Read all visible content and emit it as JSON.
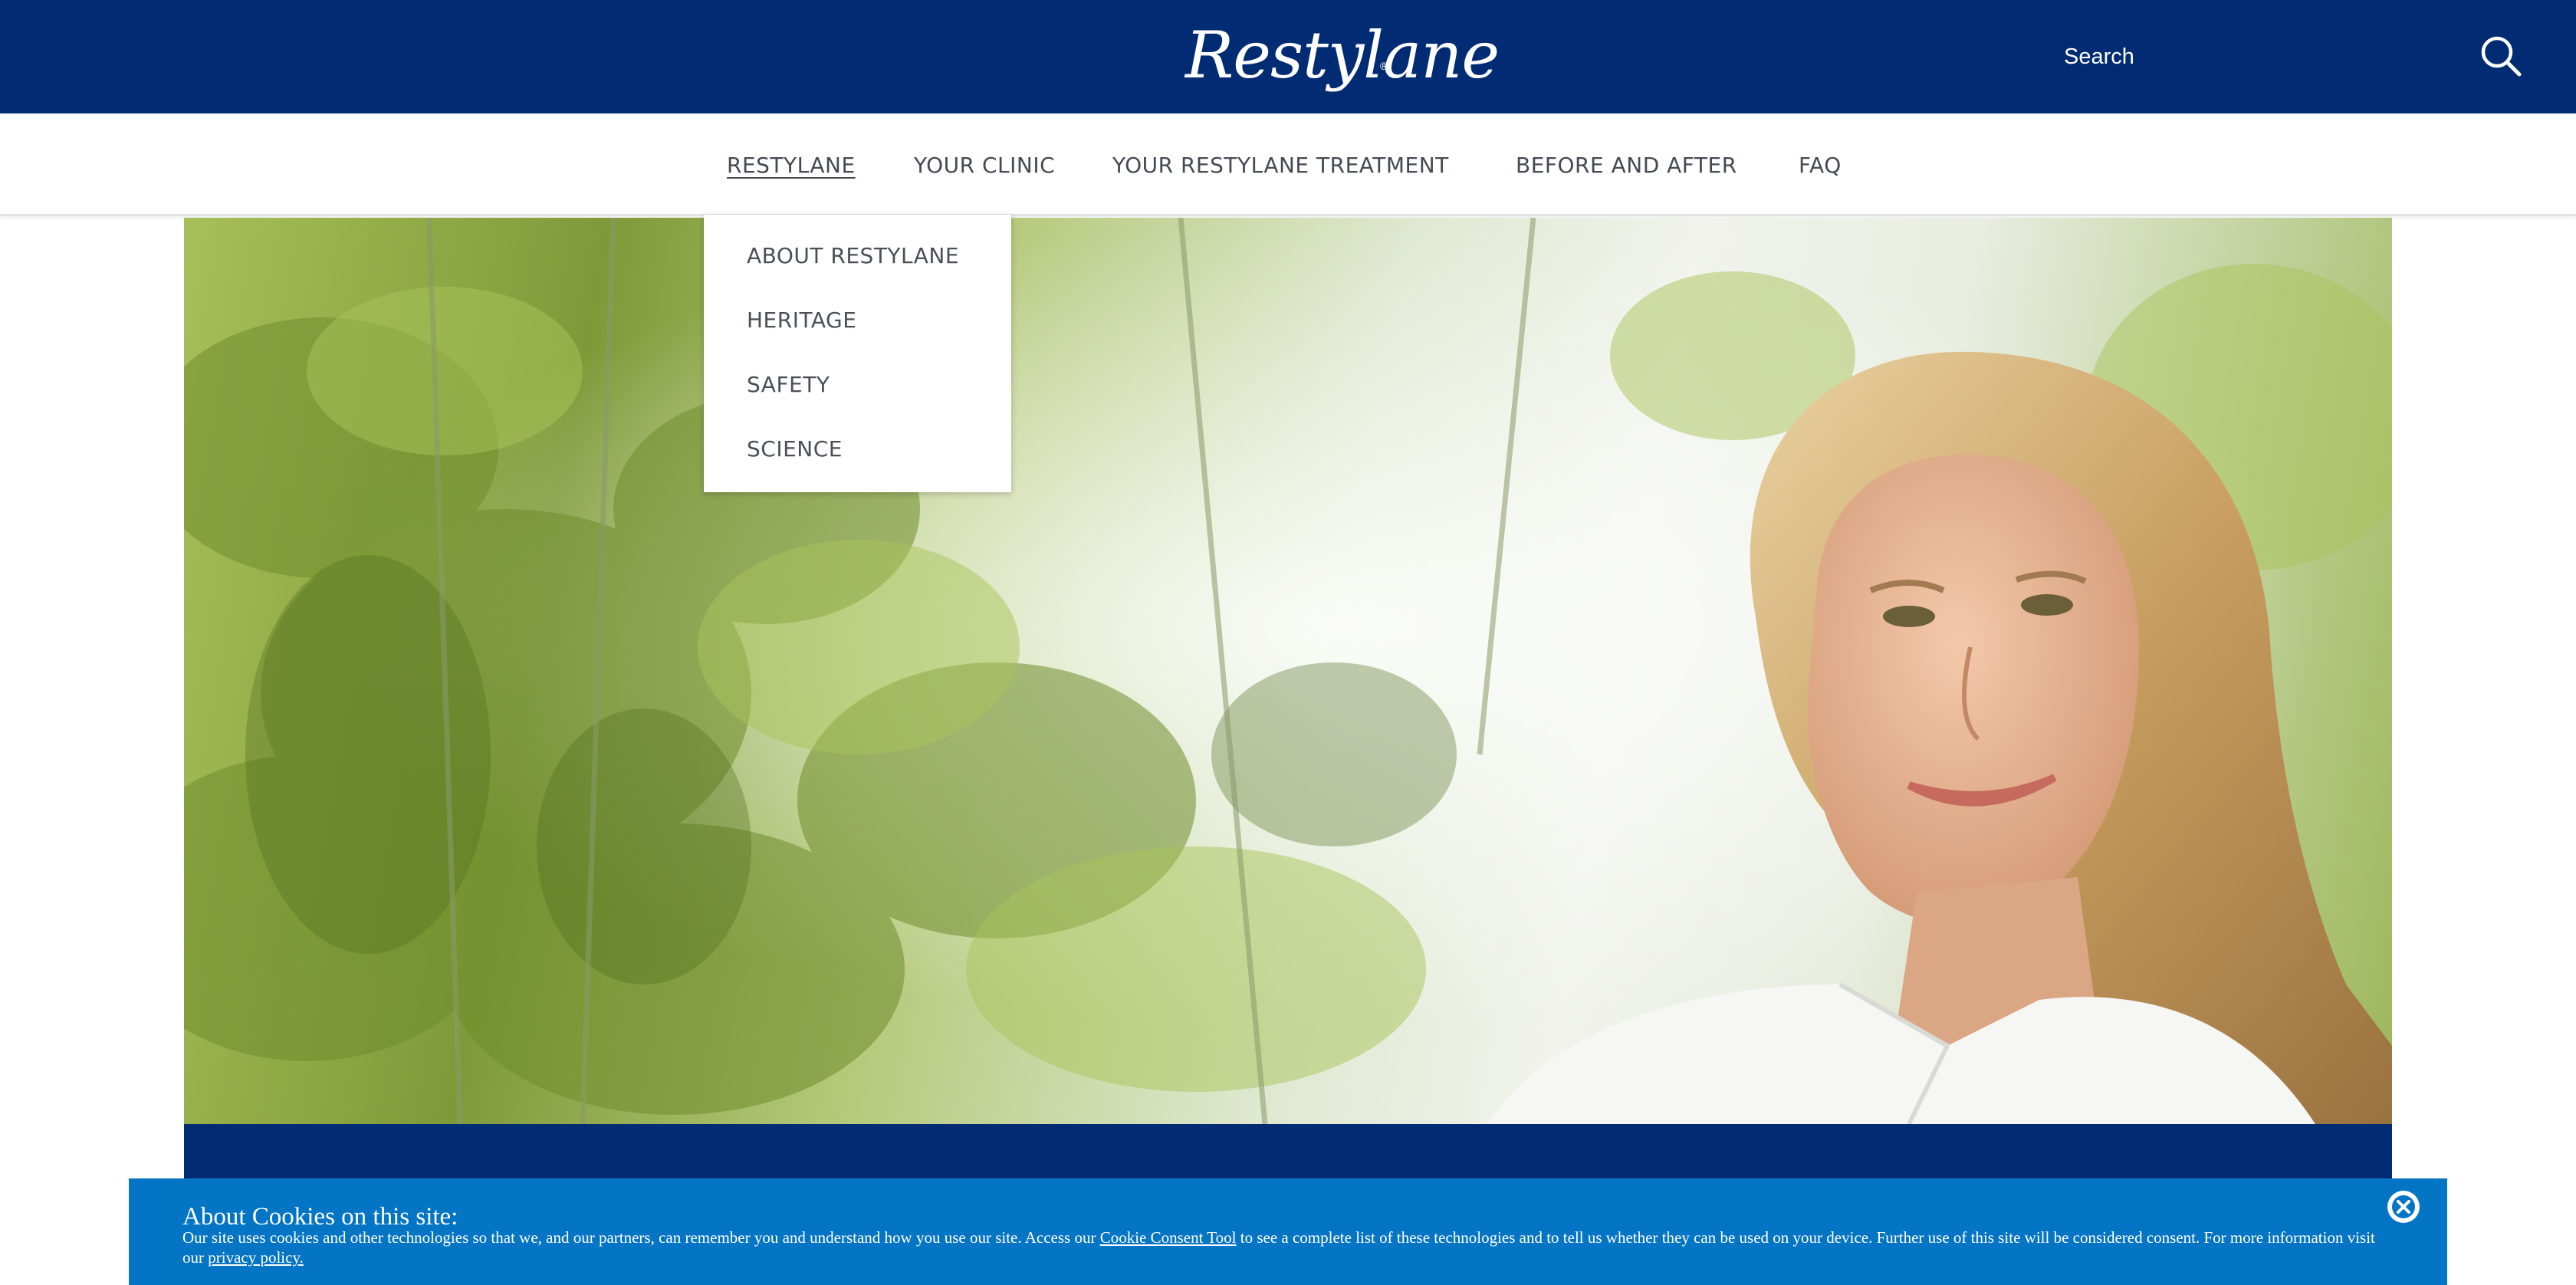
{
  "header": {
    "logo_text": "Restylane",
    "logo_mark": "®",
    "search_label": "Search",
    "search_icon": "search-icon",
    "background": "#012c73"
  },
  "nav": {
    "items": [
      {
        "label": "RESTYLANE",
        "active": true
      },
      {
        "label": "YOUR CLINIC"
      },
      {
        "label": "YOUR RESTYLANE TREATMENT"
      },
      {
        "label": "BEFORE AND AFTER"
      },
      {
        "label": "FAQ"
      }
    ]
  },
  "dropdown": {
    "items": [
      {
        "label": "ABOUT RESTYLANE"
      },
      {
        "label": "HERITAGE"
      },
      {
        "label": "SAFETY"
      },
      {
        "label": "SCIENCE"
      }
    ]
  },
  "hero": {
    "image": "woman-in-white-shirt-with-bamboo-foliage"
  },
  "cookie_banner": {
    "title": "About Cookies on this site:",
    "body_before_link": "Our site uses cookies and other technologies so that we, and our partners, can remember you and understand how you use our site. Access our ",
    "link_consent": "Cookie Consent Tool",
    "body_middle": " to see a complete list of these technologies and to tell us whether they can be used on your device. Further use of this site will be considered consent. For more information visit our ",
    "link_privacy": "privacy policy.",
    "close_icon": "close-icon",
    "background": "#0475c4"
  }
}
